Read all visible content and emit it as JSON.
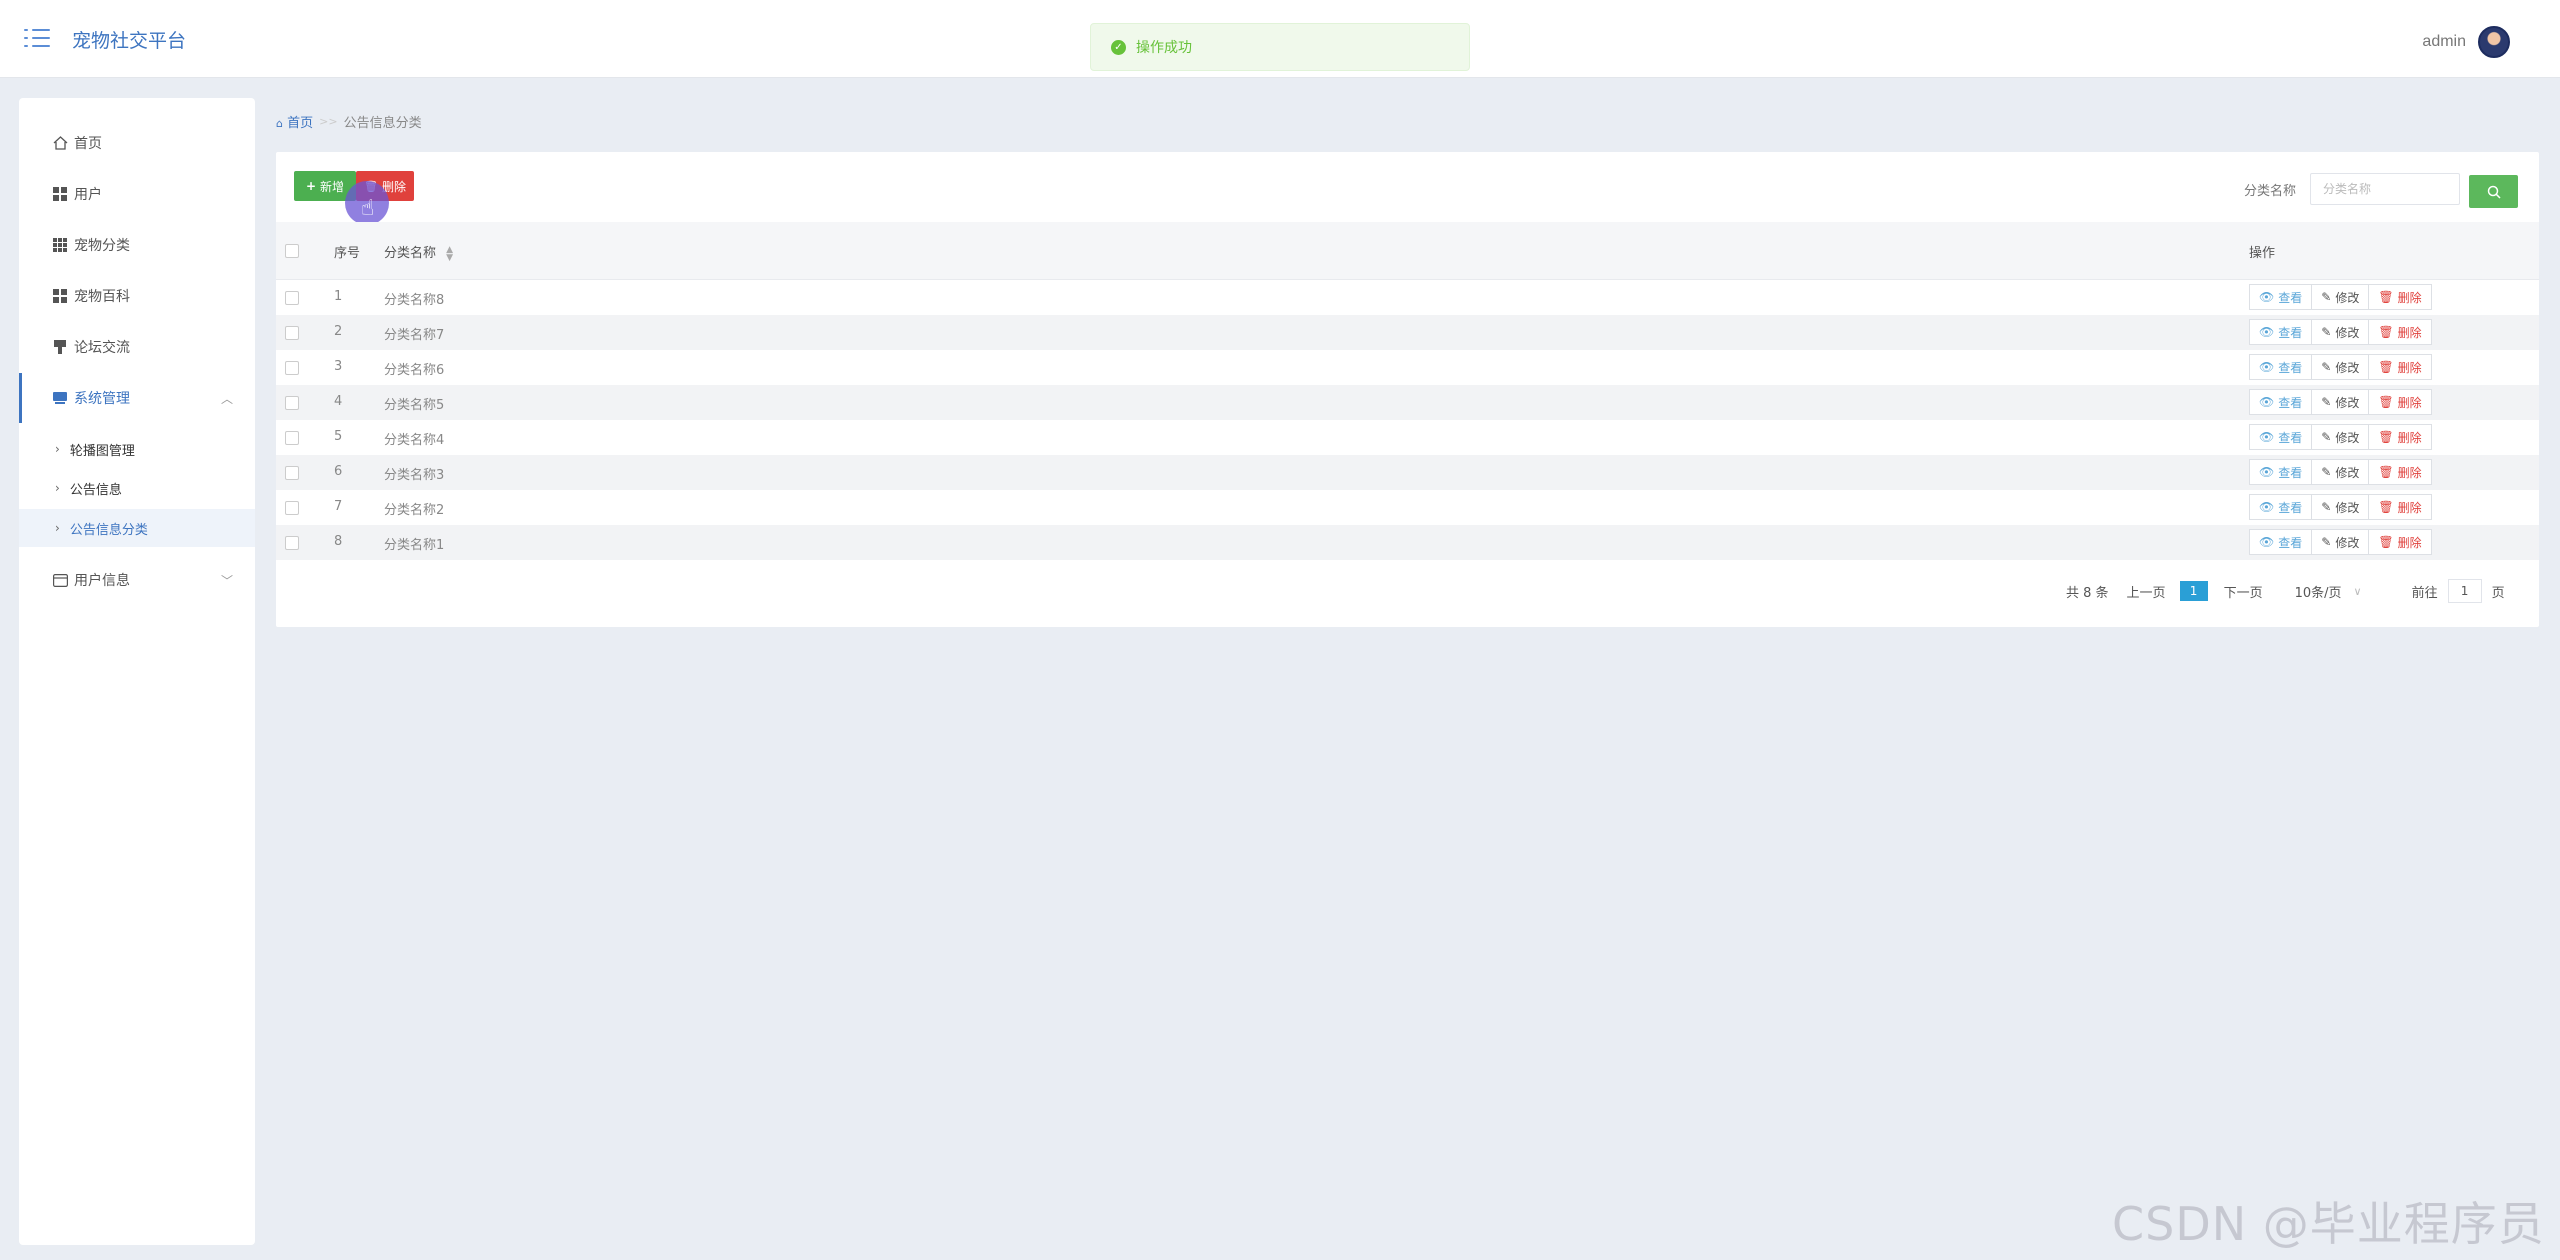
{
  "app": {
    "title": "宠物社交平台"
  },
  "user": {
    "name": "admin"
  },
  "toast": {
    "message": "操作成功"
  },
  "sidebar": {
    "items": [
      {
        "label": "首页"
      },
      {
        "label": "用户"
      },
      {
        "label": "宠物分类"
      },
      {
        "label": "宠物百科"
      },
      {
        "label": "论坛交流"
      },
      {
        "label": "系统管理"
      },
      {
        "label": "用户信息"
      }
    ],
    "sub_items": [
      {
        "label": "轮播图管理"
      },
      {
        "label": "公告信息"
      },
      {
        "label": "公告信息分类"
      }
    ]
  },
  "breadcrumb": {
    "home": "首页",
    "separator": ">>",
    "current": "公告信息分类"
  },
  "toolbar": {
    "add_label": "新增",
    "delete_label": "删除"
  },
  "search": {
    "label": "分类名称",
    "placeholder": "分类名称"
  },
  "table": {
    "headers": {
      "index": "序号",
      "name": "分类名称",
      "actions": "操作"
    },
    "rows": [
      {
        "index": "1",
        "name": "分类名称8"
      },
      {
        "index": "2",
        "name": "分类名称7"
      },
      {
        "index": "3",
        "name": "分类名称6"
      },
      {
        "index": "4",
        "name": "分类名称5"
      },
      {
        "index": "5",
        "name": "分类名称4"
      },
      {
        "index": "6",
        "name": "分类名称3"
      },
      {
        "index": "7",
        "name": "分类名称2"
      },
      {
        "index": "8",
        "name": "分类名称1"
      }
    ],
    "actions": {
      "view": "查看",
      "edit": "修改",
      "delete": "删除"
    }
  },
  "pagination": {
    "total": "共 8 条",
    "prev": "上一页",
    "current": "1",
    "next": "下一页",
    "page_size": "10条/页",
    "goto_label": "前往",
    "goto_value": "1",
    "page_unit": "页"
  },
  "watermark": "CSDN @毕业程序员",
  "colors": {
    "accent": "#3d74c0",
    "add": "#4caf50",
    "delete": "#e0413c",
    "success": "#67c23a",
    "page_active": "#2a9fd6"
  }
}
